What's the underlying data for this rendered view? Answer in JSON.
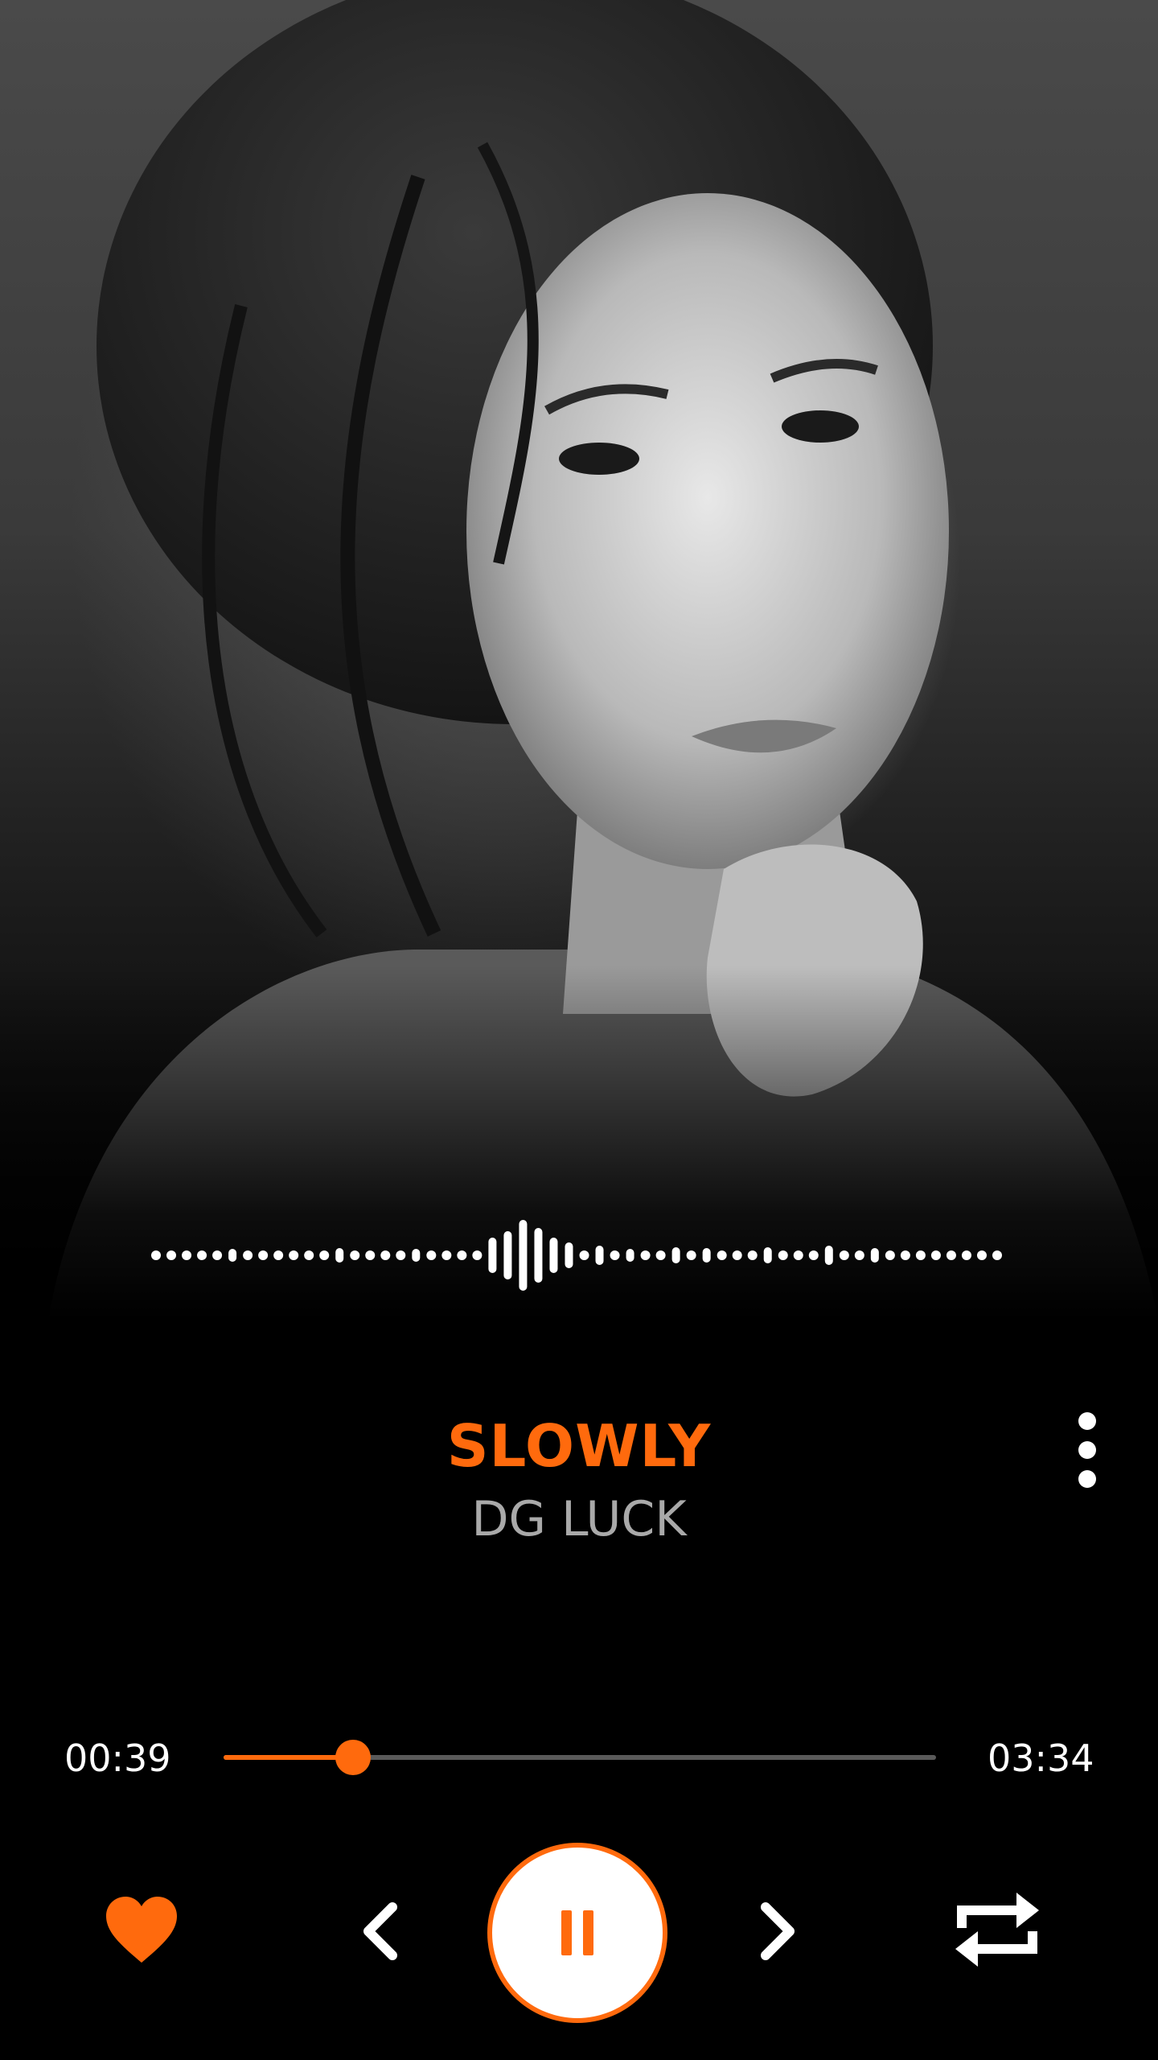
{
  "player": {
    "track": {
      "title": "SLOWLY",
      "artist": "DG LUCK"
    },
    "progress": {
      "elapsed": "00:39",
      "total": "03:34",
      "fraction": 0.182
    },
    "liked": true,
    "state": "playing"
  },
  "icons": {
    "more": "more-vertical-icon",
    "like": "heart-icon",
    "previous": "chevron-left-icon",
    "play_pause": "pause-icon",
    "next": "chevron-right-icon",
    "repeat": "repeat-icon"
  },
  "colors": {
    "accent": "#ff6a0d",
    "background": "#000000",
    "artist_text": "#a9a9a9",
    "track_inactive": "#5a5a5a"
  }
}
